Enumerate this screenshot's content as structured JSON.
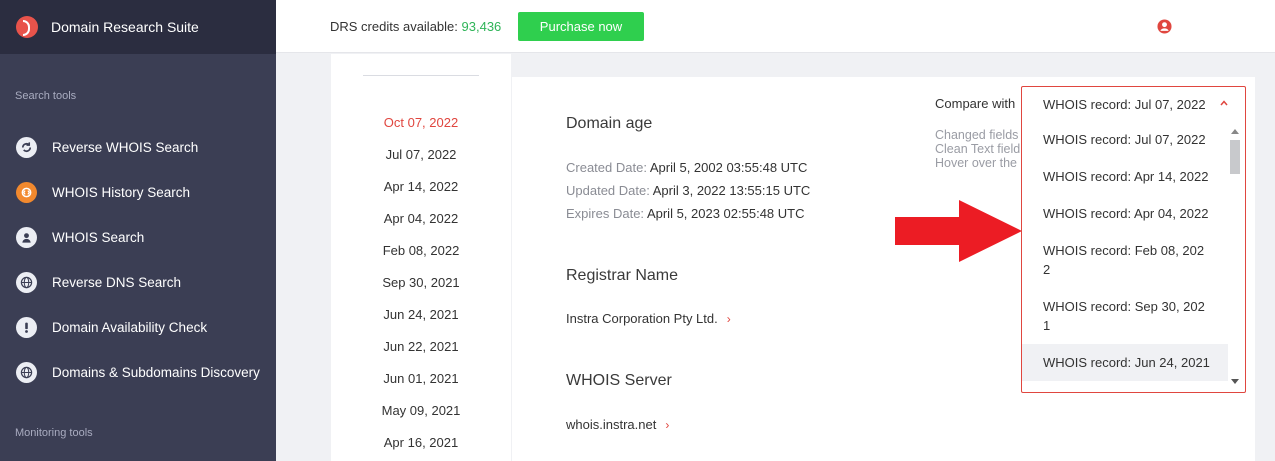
{
  "app": {
    "title": "Domain Research Suite"
  },
  "sidebar": {
    "search_tools_label": "Search tools",
    "monitoring_tools_label": "Monitoring tools",
    "items": [
      {
        "label": "Reverse WHOIS Search",
        "icon": "reverse-whois-icon"
      },
      {
        "label": "WHOIS History Search",
        "icon": "history-icon"
      },
      {
        "label": "WHOIS Search",
        "icon": "user-icon"
      },
      {
        "label": "Reverse DNS Search",
        "icon": "globe-icon"
      },
      {
        "label": "Domain Availability Check",
        "icon": "exclamation-icon"
      },
      {
        "label": "Domains & Subdomains Discovery",
        "icon": "globe-icon"
      }
    ]
  },
  "topbar": {
    "credits_label": "DRS credits available:",
    "credits_value": "93,436",
    "purchase_label": "Purchase now"
  },
  "dates": [
    "Oct 07, 2022",
    "Jul 07, 2022",
    "Apr 14, 2022",
    "Apr 04, 2022",
    "Feb 08, 2022",
    "Sep 30, 2021",
    "Jun 24, 2021",
    "Jun 22, 2021",
    "Jun 01, 2021",
    "May 09, 2021",
    "Apr 16, 2021"
  ],
  "record": {
    "domain_age_title": "Domain age",
    "created_label": "Created Date:",
    "created_value": "April 5, 2002 03:55:48 UTC",
    "updated_label": "Updated Date:",
    "updated_value": "April 3, 2022 13:55:15 UTC",
    "expires_label": "Expires Date:",
    "expires_value": "April 5, 2023 02:55:48 UTC",
    "registrar_title": "Registrar Name",
    "registrar_value": "Instra Corporation Pty Ltd.",
    "server_title": "WHOIS Server",
    "server_value": "whois.instra.net"
  },
  "compare": {
    "label": "Compare with",
    "hint_1": "Changed fields",
    "hint_2": "Clean Text field",
    "hint_3": "Hover over the",
    "selected": "WHOIS record: Jul 07, 2022",
    "options": [
      "WHOIS record: Jul 07, 2022",
      "WHOIS record: Apr 14, 2022",
      "WHOIS record: Apr 04, 2022",
      "WHOIS record: Feb 08, 202\n2",
      "WHOIS record: Sep 30, 202\n1",
      "WHOIS record: Jun 24, 2021"
    ]
  },
  "colors": {
    "accent": "#e0463f",
    "sidebar": "#3b3e54",
    "brand_bar": "#2b2d40",
    "purchase": "#2fcf4e",
    "credits": "#2fb458",
    "arrow": "#ec1c24"
  }
}
